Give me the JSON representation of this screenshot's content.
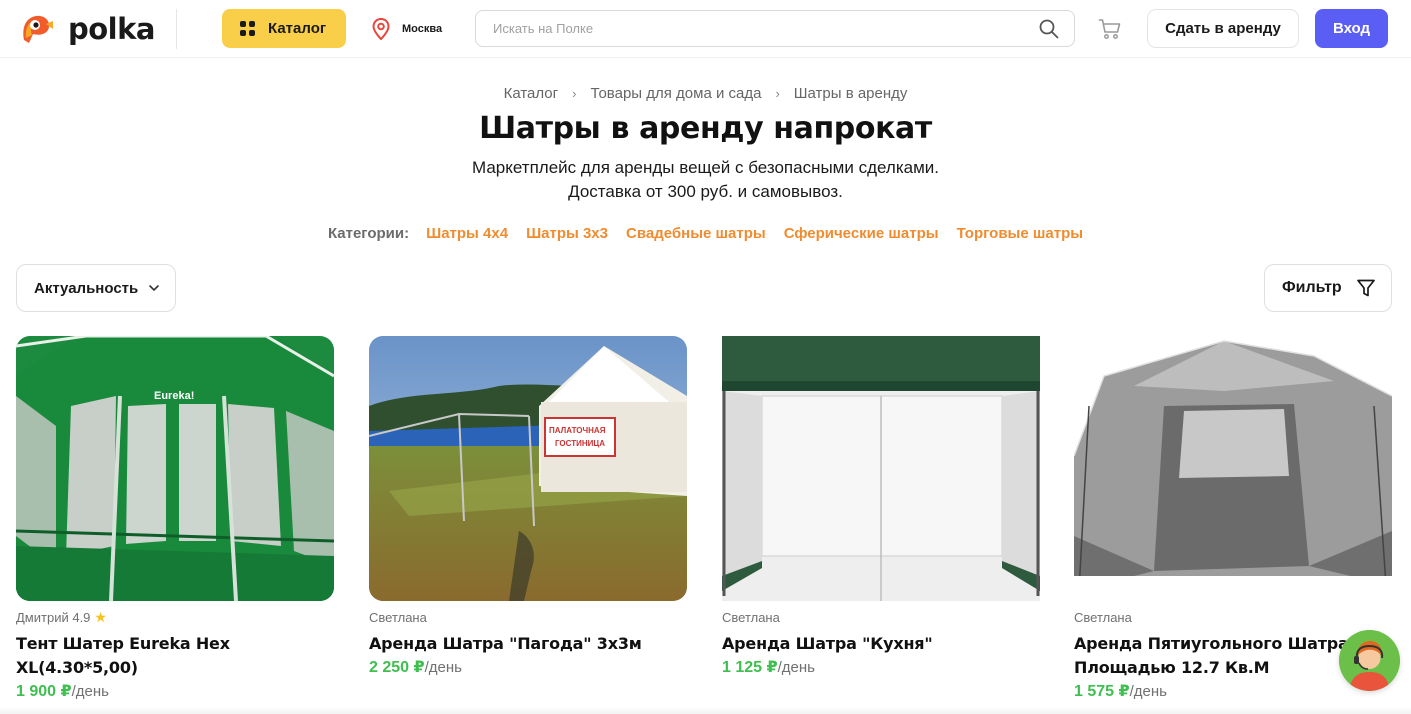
{
  "header": {
    "logo_text": "polka",
    "catalog_label": "Каталог",
    "city": "Москва",
    "search_placeholder": "Искать на Полке",
    "rent_out_label": "Сдать в аренду",
    "login_label": "Вход",
    "icons": [
      "logo-mascot-icon",
      "grid-icon",
      "location-pin-icon",
      "search-icon",
      "cart-icon"
    ],
    "colors": {
      "catalog_bg": "#f9cf4a",
      "login_bg": "#5b5ef5",
      "pin": "#e8453c"
    }
  },
  "breadcrumb": {
    "items": [
      "Каталог",
      "Товары для дома и сада",
      "Шатры в аренду"
    ]
  },
  "page": {
    "title": "Шатры в аренду напрокат",
    "subtitle_line1": "Маркетплейс для аренды вещей с безопасными сделками.",
    "subtitle_line2": "Доставка от 300 руб. и самовывоз."
  },
  "categories": {
    "label": "Категории:",
    "links": [
      "Шатры 4х4",
      "Шатры 3х3",
      "Свадебные шатры",
      "Сферические шатры",
      "Торговые шатры"
    ],
    "link_color": "#f08c2f"
  },
  "controls": {
    "sort_label": "Актуальность",
    "filter_label": "Фильтр",
    "icons": [
      "chevron-down-icon",
      "funnel-icon"
    ]
  },
  "products": [
    {
      "seller": "Дмитрий",
      "rating": "4.9",
      "rating_icon": "star-icon",
      "title": "Тент Шатер Eureka Hex XL(4.30*5,00)",
      "price": "1 900 ₽",
      "unit": "/день",
      "image_text": "Eureka!"
    },
    {
      "seller": "Светлана",
      "title": "Аренда Шатра \"Пагода\" 3х3м",
      "price": "2 250 ₽",
      "unit": "/день",
      "image_text_line1": "ПАЛАТОЧНАЯ",
      "image_text_line2": "ГОСТИНИЦА"
    },
    {
      "seller": "Светлана",
      "title": "Аренда Шатра \"Кухня\"",
      "price": "1 125 ₽",
      "unit": "/день"
    },
    {
      "seller": "Светлана",
      "title_line1": "Аренда Пятиугольного Шатра",
      "title_line2": "Площадью 12.7 Кв.М",
      "price": "1 575 ₽",
      "unit": "/день"
    }
  ],
  "price_color": "#3fbf4f",
  "support_widget_icon": "support-agent-icon"
}
